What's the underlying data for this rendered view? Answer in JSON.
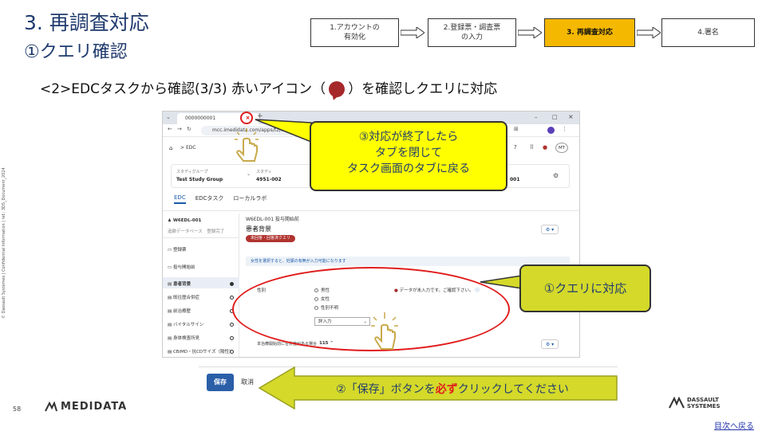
{
  "header": {
    "title": "3. 再調査対応",
    "subtitle": "①クエリ確認",
    "instruction_before": "<2>EDCタスクから確認(3/3)  赤いアイコン（",
    "instruction_after": "）を確認しクエリに対応"
  },
  "steps": [
    {
      "label_line1": "1.アカウントの",
      "label_line2": "有効化",
      "active": false
    },
    {
      "label_line1": "2.登録票・調査票",
      "label_line2": "の入力",
      "active": false
    },
    {
      "label_line1": "3. 再調査対応",
      "label_line2": "",
      "active": true
    },
    {
      "label_line1": "4.署名",
      "label_line2": "",
      "active": false
    }
  ],
  "side_note": "© Dassault Systèmes | Confidential Information | ref.: 3DS_Document_2024",
  "footer": {
    "page_number": "58",
    "medidata_logo": "MEDIDATA",
    "ds_logo_line1": "DASSAULT",
    "ds_logo_line2": "SYSTEMES",
    "toc_link": "目次へ戻る"
  },
  "browser": {
    "tab_title": "0000000001",
    "url": "mcc.imedidata.com/apps/t2/...",
    "breadcrumb": "EDC",
    "avatar": "MT",
    "study_group_label": "スタディグループ",
    "study_group_value": "Test Study Group",
    "study_label": "スタディ",
    "study_value": "4951-002",
    "site_value": "001",
    "tabs": [
      "EDC",
      "EDCタスク",
      "ローカルラボ"
    ],
    "subject_id": "W6EDL-001",
    "subject_status1": "追跡データベース",
    "subject_status2": "登録完了",
    "left_items": [
      {
        "label": "登録票",
        "dot": ""
      },
      {
        "label": "投与開始前",
        "dot": ""
      },
      {
        "label": "患者背景",
        "dot": "filled"
      },
      {
        "label": "既往歴合併症",
        "dot": "empty"
      },
      {
        "label": "前治療歴",
        "dot": "empty"
      },
      {
        "label": "バイタルサイン",
        "dot": "empty"
      },
      {
        "label": "身体検査所見",
        "dot": "empty"
      },
      {
        "label": "CBiMD・抗CDサイズ（陽性）",
        "dot": "empty"
      }
    ],
    "form_header": "W6EDL-001  投与開始前",
    "form_title": "患者背景",
    "form_badge": "未回答・回答済クエリ",
    "form_banner": "女性を選択すると、妊娠の有無が入力可能になります",
    "field_label": "性別",
    "radio_options": [
      "男性",
      "女性",
      "性別不明"
    ],
    "query_text": "データが未入力です。ご確認下さい。",
    "select_value": "詳入力",
    "row2_label": "本治療開始前に合併症がある場合",
    "row2_value": "115"
  },
  "callouts": {
    "c3_line1": "③対応が終了したら",
    "c3_line2": "タブを閉じて",
    "c3_line3": "タスク画面のタブに戻る",
    "c1": "①クエリに対応",
    "c2_before": "②「保存」ボタンを",
    "c2_emph": "必ず",
    "c2_after": "クリックしてください"
  },
  "savebar": {
    "save_label": "保存",
    "cancel_label": "取消"
  },
  "colors": {
    "title": "#1f3a6e",
    "active_step": "#f5b800",
    "callout_yellow": "#ffff00",
    "callout_olive": "#d4d92a",
    "highlight_red": "#e01c1c",
    "query_icon": "#a5282b"
  }
}
